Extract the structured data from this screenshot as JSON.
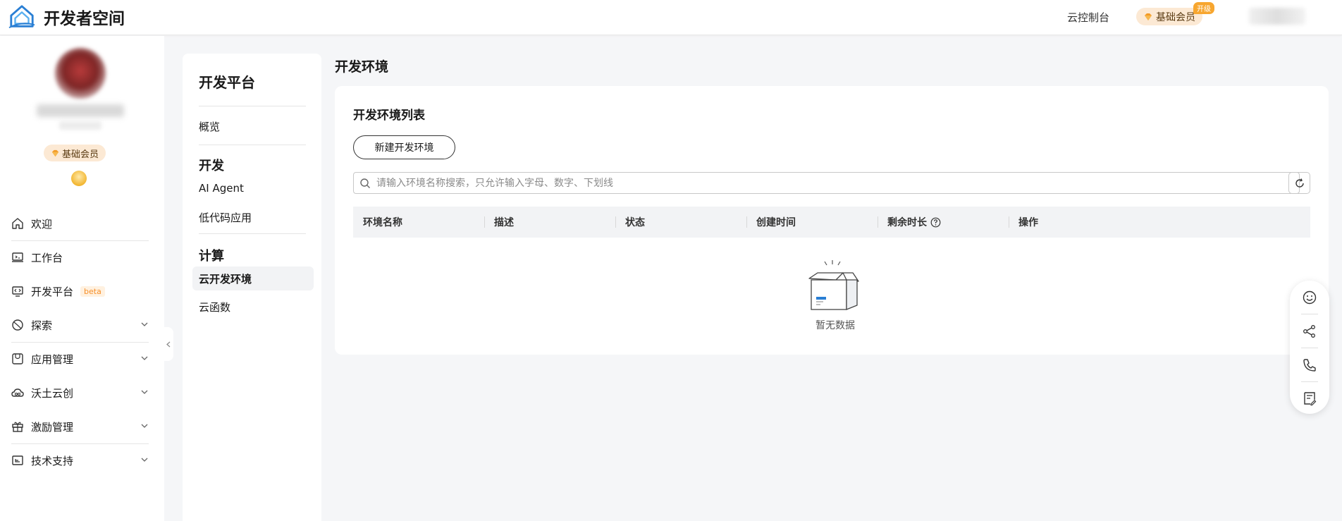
{
  "header": {
    "logo_text": "开发者空间",
    "console_link": "云控制台",
    "member_badge": "基础会员",
    "upgrade_tag": "开级"
  },
  "sidebar": {
    "member_badge": "基础会员",
    "items": [
      {
        "label": "欢迎",
        "icon": "home-icon",
        "expandable": false
      },
      {
        "label": "工作台",
        "icon": "workbench-icon",
        "expandable": false
      },
      {
        "label": "开发平台",
        "icon": "devplatform-icon",
        "expandable": false,
        "badge": "beta"
      },
      {
        "label": "探索",
        "icon": "explore-icon",
        "expandable": true
      },
      {
        "label": "应用管理",
        "icon": "app-manage-icon",
        "expandable": true
      },
      {
        "label": "沃土云创",
        "icon": "cloud-icon",
        "expandable": true
      },
      {
        "label": "激励管理",
        "icon": "gift-icon",
        "expandable": true
      },
      {
        "label": "技术支持",
        "icon": "support-icon",
        "expandable": true
      }
    ]
  },
  "subnav": {
    "title": "开发平台",
    "overview": "概览",
    "group_dev": "开发",
    "ai_agent": "AI Agent",
    "lowcode": "低代码应用",
    "group_compute": "计算",
    "cloud_dev_env": "云开发环境",
    "cloud_function": "云函数"
  },
  "main": {
    "page_title": "开发环境",
    "card_title": "开发环境列表",
    "new_button": "新建开发环境",
    "search_placeholder": "请输入环境名称搜索，只允许输入字母、数字、下划线",
    "columns": [
      "环境名称",
      "描述",
      "状态",
      "创建时间",
      "剩余时长",
      "操作"
    ],
    "empty_text": "暂无数据"
  },
  "floating_toolbar": [
    "smile-icon",
    "share-icon",
    "phone-icon",
    "feedback-icon"
  ],
  "colors": {
    "accent_orange": "#f7a62f",
    "member_bg": "#fce9d4",
    "logo_blue": "#2a7fd4"
  }
}
